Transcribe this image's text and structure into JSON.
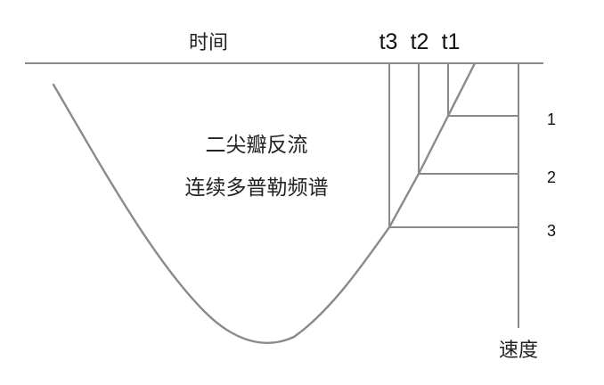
{
  "diagram": {
    "time_axis_label": "时间",
    "velocity_axis_label": "速度",
    "time_markers": [
      "t3",
      "t2",
      "t1"
    ],
    "velocity_levels": [
      "1",
      "2",
      "3"
    ],
    "center_text": {
      "line1": "二尖瓣反流",
      "line2": "连续多普勒频谱"
    },
    "colors": {
      "line": "#8a8a8a",
      "text": "#222222",
      "background": "#ffffff"
    }
  }
}
